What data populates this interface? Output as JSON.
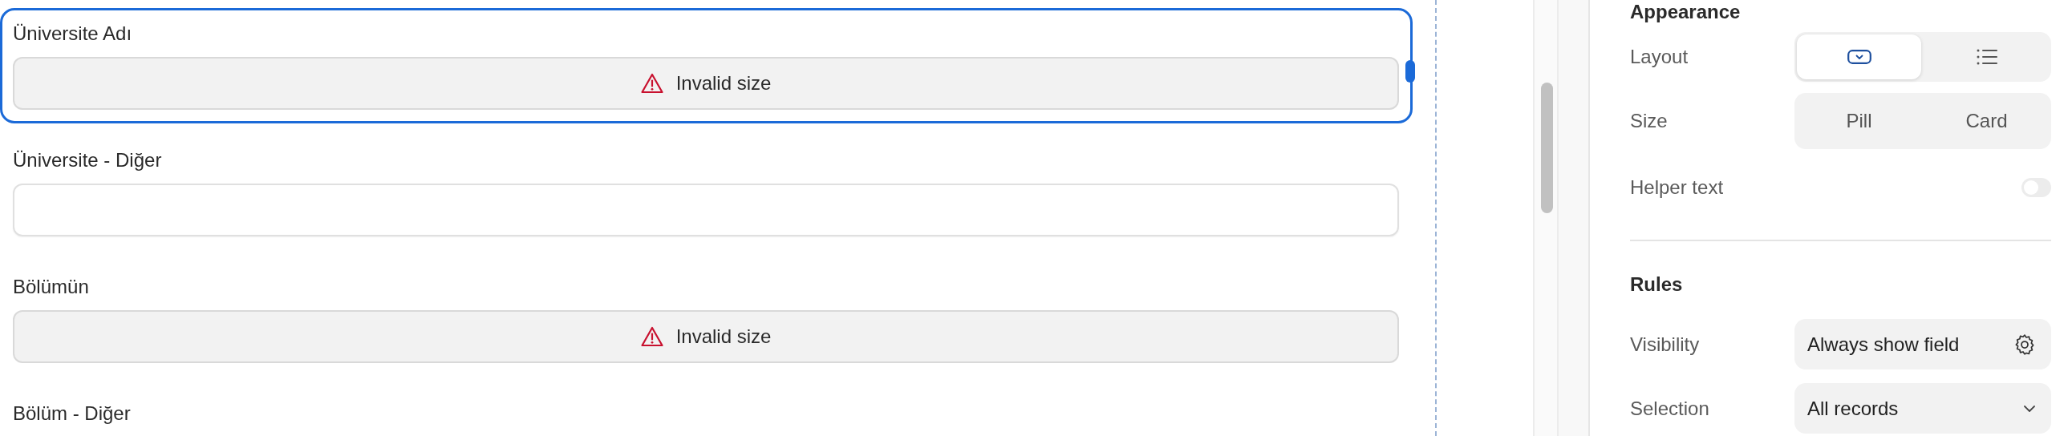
{
  "canvas": {
    "fields": [
      {
        "label": "Üniversite Adı",
        "kind": "invalid",
        "message": "Invalid size",
        "selected": true
      },
      {
        "label": "Üniversite - Diğer",
        "kind": "text",
        "selected": false
      },
      {
        "label": "Bölümün",
        "kind": "invalid",
        "message": "Invalid size",
        "selected": false
      },
      {
        "label": "Bölüm - Diğer",
        "selected": false
      }
    ]
  },
  "panel": {
    "appearance": {
      "title": "Appearance",
      "layout": {
        "label": "Layout",
        "options": [
          {
            "kind": "dropdown",
            "selected": true
          },
          {
            "kind": "list",
            "selected": false
          }
        ]
      },
      "size": {
        "label": "Size",
        "options": [
          {
            "label": "Pill",
            "selected": false
          },
          {
            "label": "Card",
            "selected": false
          }
        ]
      },
      "helper_text": {
        "label": "Helper text",
        "on": false
      }
    },
    "rules": {
      "title": "Rules",
      "visibility": {
        "label": "Visibility",
        "value": "Always show field"
      },
      "selection": {
        "label": "Selection",
        "value": "All records"
      }
    }
  }
}
